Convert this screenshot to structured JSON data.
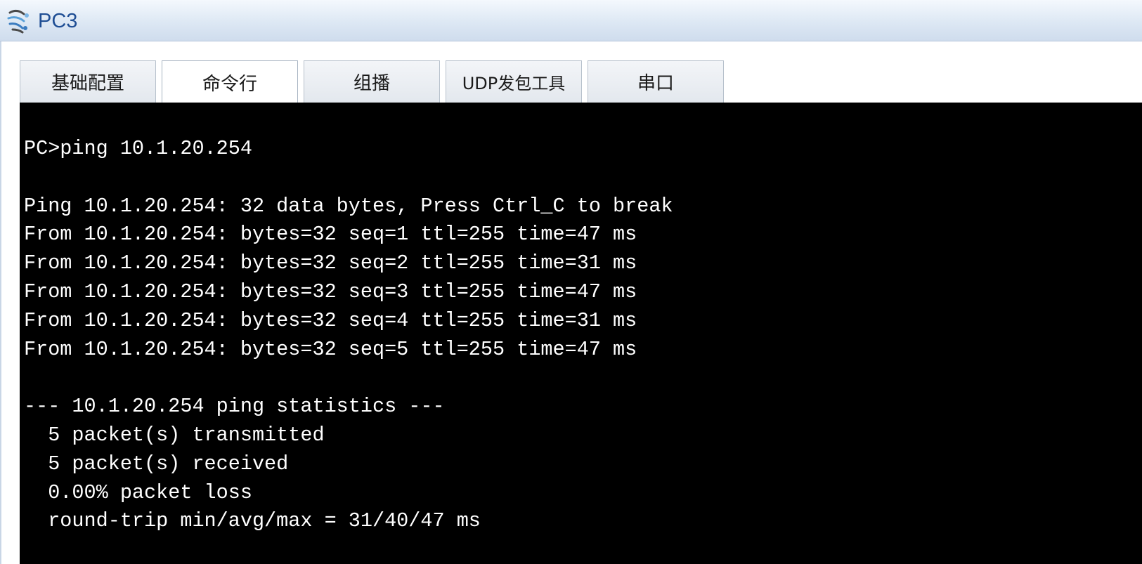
{
  "window": {
    "title": "PC3"
  },
  "tabs": [
    {
      "label": "基础配置",
      "active": false
    },
    {
      "label": "命令行",
      "active": true
    },
    {
      "label": "组播",
      "active": false
    },
    {
      "label": "UDP发包工具",
      "active": false
    },
    {
      "label": "串口",
      "active": false
    }
  ],
  "terminal": {
    "lines": [
      "PC>ping 10.1.20.254",
      "",
      "Ping 10.1.20.254: 32 data bytes, Press Ctrl_C to break",
      "From 10.1.20.254: bytes=32 seq=1 ttl=255 time=47 ms",
      "From 10.1.20.254: bytes=32 seq=2 ttl=255 time=31 ms",
      "From 10.1.20.254: bytes=32 seq=3 ttl=255 time=47 ms",
      "From 10.1.20.254: bytes=32 seq=4 ttl=255 time=31 ms",
      "From 10.1.20.254: bytes=32 seq=5 ttl=255 time=47 ms",
      "",
      "--- 10.1.20.254 ping statistics ---",
      "  5 packet(s) transmitted",
      "  5 packet(s) received",
      "  0.00% packet loss",
      "  round-trip min/avg/max = 31/40/47 ms"
    ]
  },
  "colors": {
    "title_text": "#1f4e94",
    "terminal_bg": "#000000",
    "terminal_fg": "#ffffff"
  },
  "icons": {
    "title": "pc-network-icon"
  }
}
